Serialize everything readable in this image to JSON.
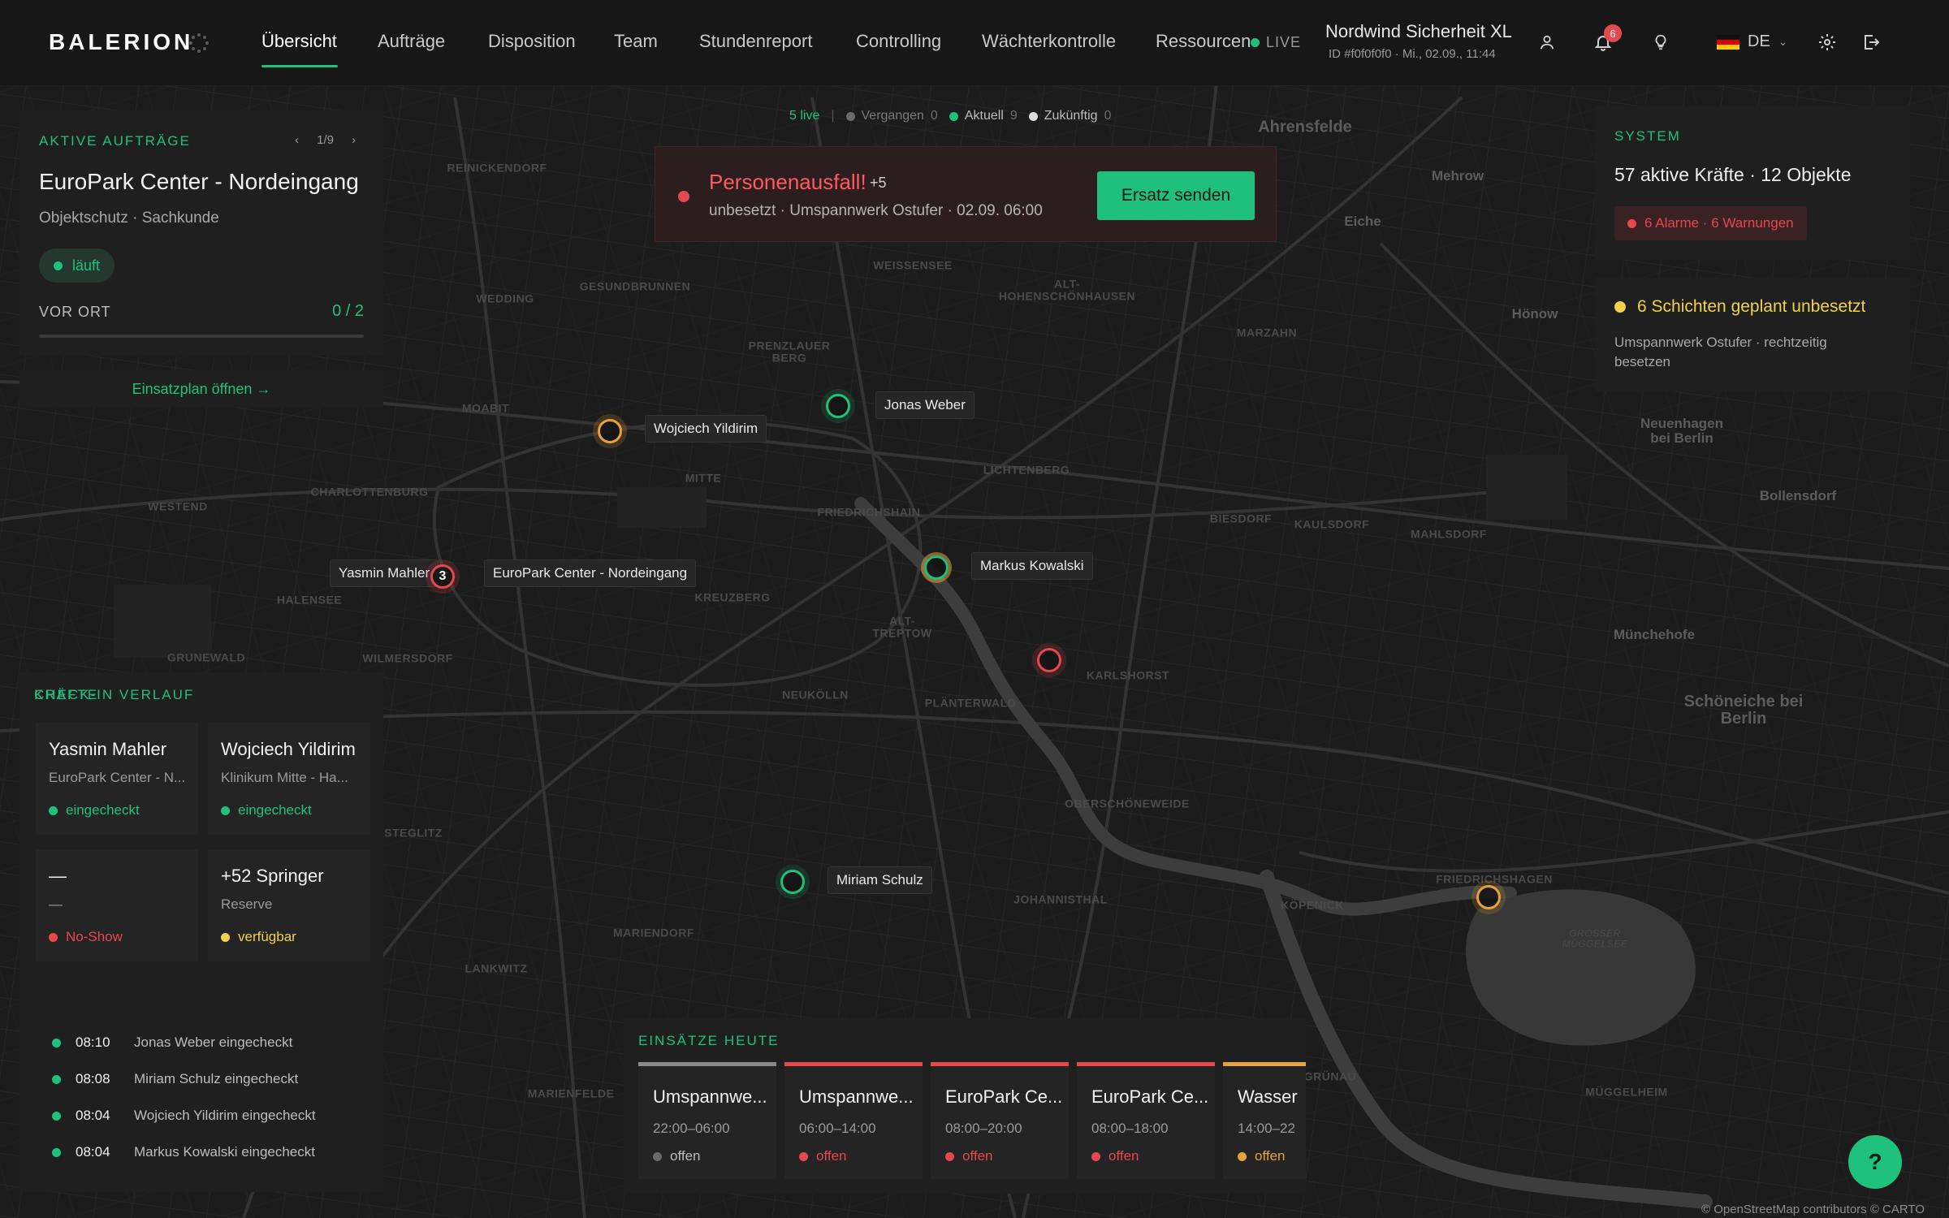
{
  "app": {
    "brand": "BALERION"
  },
  "nav": {
    "items": [
      "Übersicht",
      "Aufträge",
      "Disposition",
      "Team",
      "Stundenreport",
      "Controlling",
      "Wächterkontrolle",
      "Ressourcen"
    ],
    "active": "Übersicht",
    "live_label": "LIVE"
  },
  "company": {
    "name": "Nordwind Sicherheit XL",
    "id_line": "ID #f0f0f0f0 · Mi., 02.09., 11:44"
  },
  "notifications": {
    "count": "6"
  },
  "language": {
    "code": "DE"
  },
  "filterbar": {
    "live": "5 live",
    "filters": [
      {
        "label": "Vergangen",
        "count": "0",
        "color": "#6b6b6b"
      },
      {
        "label": "Aktuell",
        "count": "9",
        "color": "#1ec27c"
      },
      {
        "label": "Zukünftig",
        "count": "0",
        "color": "#dcdcdc"
      }
    ]
  },
  "alert": {
    "title": "Personenausfall!",
    "more": "+5",
    "subtitle": "unbesetzt · Umspannwerk Ostufer · 02.09. 06:00",
    "button": "Ersatz senden"
  },
  "active_order": {
    "section_title": "AKTIVE AUFTRÄGE",
    "pager": "1/9",
    "title": "EuroPark Center - Nordeingang",
    "subtitle": "Objektschutz · Sachkunde",
    "status": "läuft",
    "on_site_label": "VOR ORT",
    "on_site_value": "0 / 2",
    "on_site_fraction": 0,
    "plan_link": "Einsatzplan öffnen →"
  },
  "system": {
    "section_title": "SYSTEM",
    "summary": "57 aktive Kräfte · 12 Objekte",
    "alarms": "6 Alarme · 6 Warnungen"
  },
  "unbesetzt": {
    "title": "6 Schichten geplant unbesetzt",
    "text": "Umspannwerk Ostufer · rechtzeitig besetzen"
  },
  "kraefte": {
    "section_title": "KRÄFTE",
    "cards": [
      {
        "name": "Yasmin Mahler",
        "sub": "EuroPark Center - N...",
        "status": "eingecheckt",
        "color": "g"
      },
      {
        "name": "Wojciech Yildirim",
        "sub": "Klinikum Mitte - Ha...",
        "status": "eingecheckt",
        "color": "g"
      },
      {
        "name": "—",
        "sub": "—",
        "status": "No-Show",
        "color": "r"
      },
      {
        "name": "+52 Springer",
        "sub": "Reserve",
        "status": "verfügbar",
        "color": "y"
      }
    ],
    "checkin_title": "CHECK-IN VERLAUF",
    "checkins": [
      {
        "time": "08:10",
        "text": "Jonas Weber eingecheckt"
      },
      {
        "time": "08:08",
        "text": "Miriam Schulz eingecheckt"
      },
      {
        "time": "08:04",
        "text": "Wojciech Yildirim eingecheckt"
      },
      {
        "time": "08:04",
        "text": "Markus Kowalski eingecheckt"
      }
    ]
  },
  "einsaetze": {
    "section_title": "EINSÄTZE HEUTE",
    "cards": [
      {
        "name": "Umspannwe...",
        "time": "22:00–06:00",
        "status": "offen",
        "bar": "#8a8a8a",
        "dot": "gr",
        "status_color": "#bdbdbd"
      },
      {
        "name": "Umspannwe...",
        "time": "06:00–14:00",
        "status": "offen",
        "bar": "#e5484d",
        "dot": "r",
        "status_color": "#e5484d"
      },
      {
        "name": "EuroPark Ce...",
        "time": "08:00–20:00",
        "status": "offen",
        "bar": "#e5484d",
        "dot": "r",
        "status_color": "#e5484d"
      },
      {
        "name": "EuroPark Ce...",
        "time": "08:00–18:00",
        "status": "offen",
        "bar": "#e5484d",
        "dot": "r",
        "status_color": "#e5484d"
      },
      {
        "name": "Wasser",
        "time": "14:00–22",
        "status": "offen",
        "bar": "#e9a23a",
        "dot": "o",
        "status_color": "#e9a23a"
      }
    ]
  },
  "map": {
    "labels": {
      "reinickendorf": "REINICKENDORF",
      "gesundbrunnen": "GESUNDBRUNNEN",
      "wedding": "WEDDING",
      "weissensee": "WEISSENSEE",
      "alt_hohen": "ALT-HOHENSCHÖNHAUSEN",
      "marzahn": "MARZAHN",
      "prenzlauer": "PRENZLAUER BERG",
      "moabit": "MOABIT",
      "mitte": "MITTE",
      "lichtenberg": "LICHTENBERG",
      "charlottenburg": "CHARLOTTENBURG",
      "friedrichshain": "FRIEDRICHSHAIN",
      "westend": "WESTEND",
      "biesdorf": "BIESDORF",
      "kaulsdorf": "KAULSDORF",
      "mahlsdorf": "MAHLSDORF",
      "halensee": "HALENSEE",
      "kreuzberg": "KREUZBERG",
      "alt_treptow": "ALT-TREPTOW",
      "grunewald": "GRUNEWALD",
      "wilmersdorf": "WILMERSDORF",
      "karlshorst": "KARLSHORST",
      "neukolln": "NEUKÖLLN",
      "planterwald": "PLÄNTERWALD",
      "oberschoeneweide": "OBERSCHÖNEWEIDE",
      "steglitz": "STEGLITZ",
      "johannisthal": "JOHANNISTHAL",
      "koepenick": "KÖPENICK",
      "friedrichshagen": "FRIEDRICHSHAGEN",
      "mariendorf": "MARIENDORF",
      "lankwitz": "LANKWITZ",
      "marienfelde": "MARIENFELDE",
      "gruenau": "GRÜNAU",
      "mahlsdorf2": "",
      "ahrensfelde": "Ahrensfelde",
      "mehrow": "Mehrow",
      "eiche": "Eiche",
      "hoenow": "Hönow",
      "neuenhagen": "Neuenhagen bei Berlin",
      "bollensdorf": "Bollensdorf",
      "muenchehofe": "Münchehofe",
      "schoeneiche": "Schöneiche bei Berlin",
      "mueggelheim": "MÜGGELHEIM",
      "grosser_mueggelsee": "Großer Müggelsee"
    },
    "people": {
      "wojciech": "Wojciech Yildirim",
      "jonas": "Jonas Weber",
      "yasmin": "Yasmin Mahler",
      "europark": "EuroPark Center - Nordeingang",
      "markus": "Markus Kowalski",
      "miriam": "Miriam Schulz",
      "cluster_count": "3"
    },
    "attribution": "© OpenStreetMap contributors © CARTO"
  },
  "help": {
    "label": "?"
  }
}
